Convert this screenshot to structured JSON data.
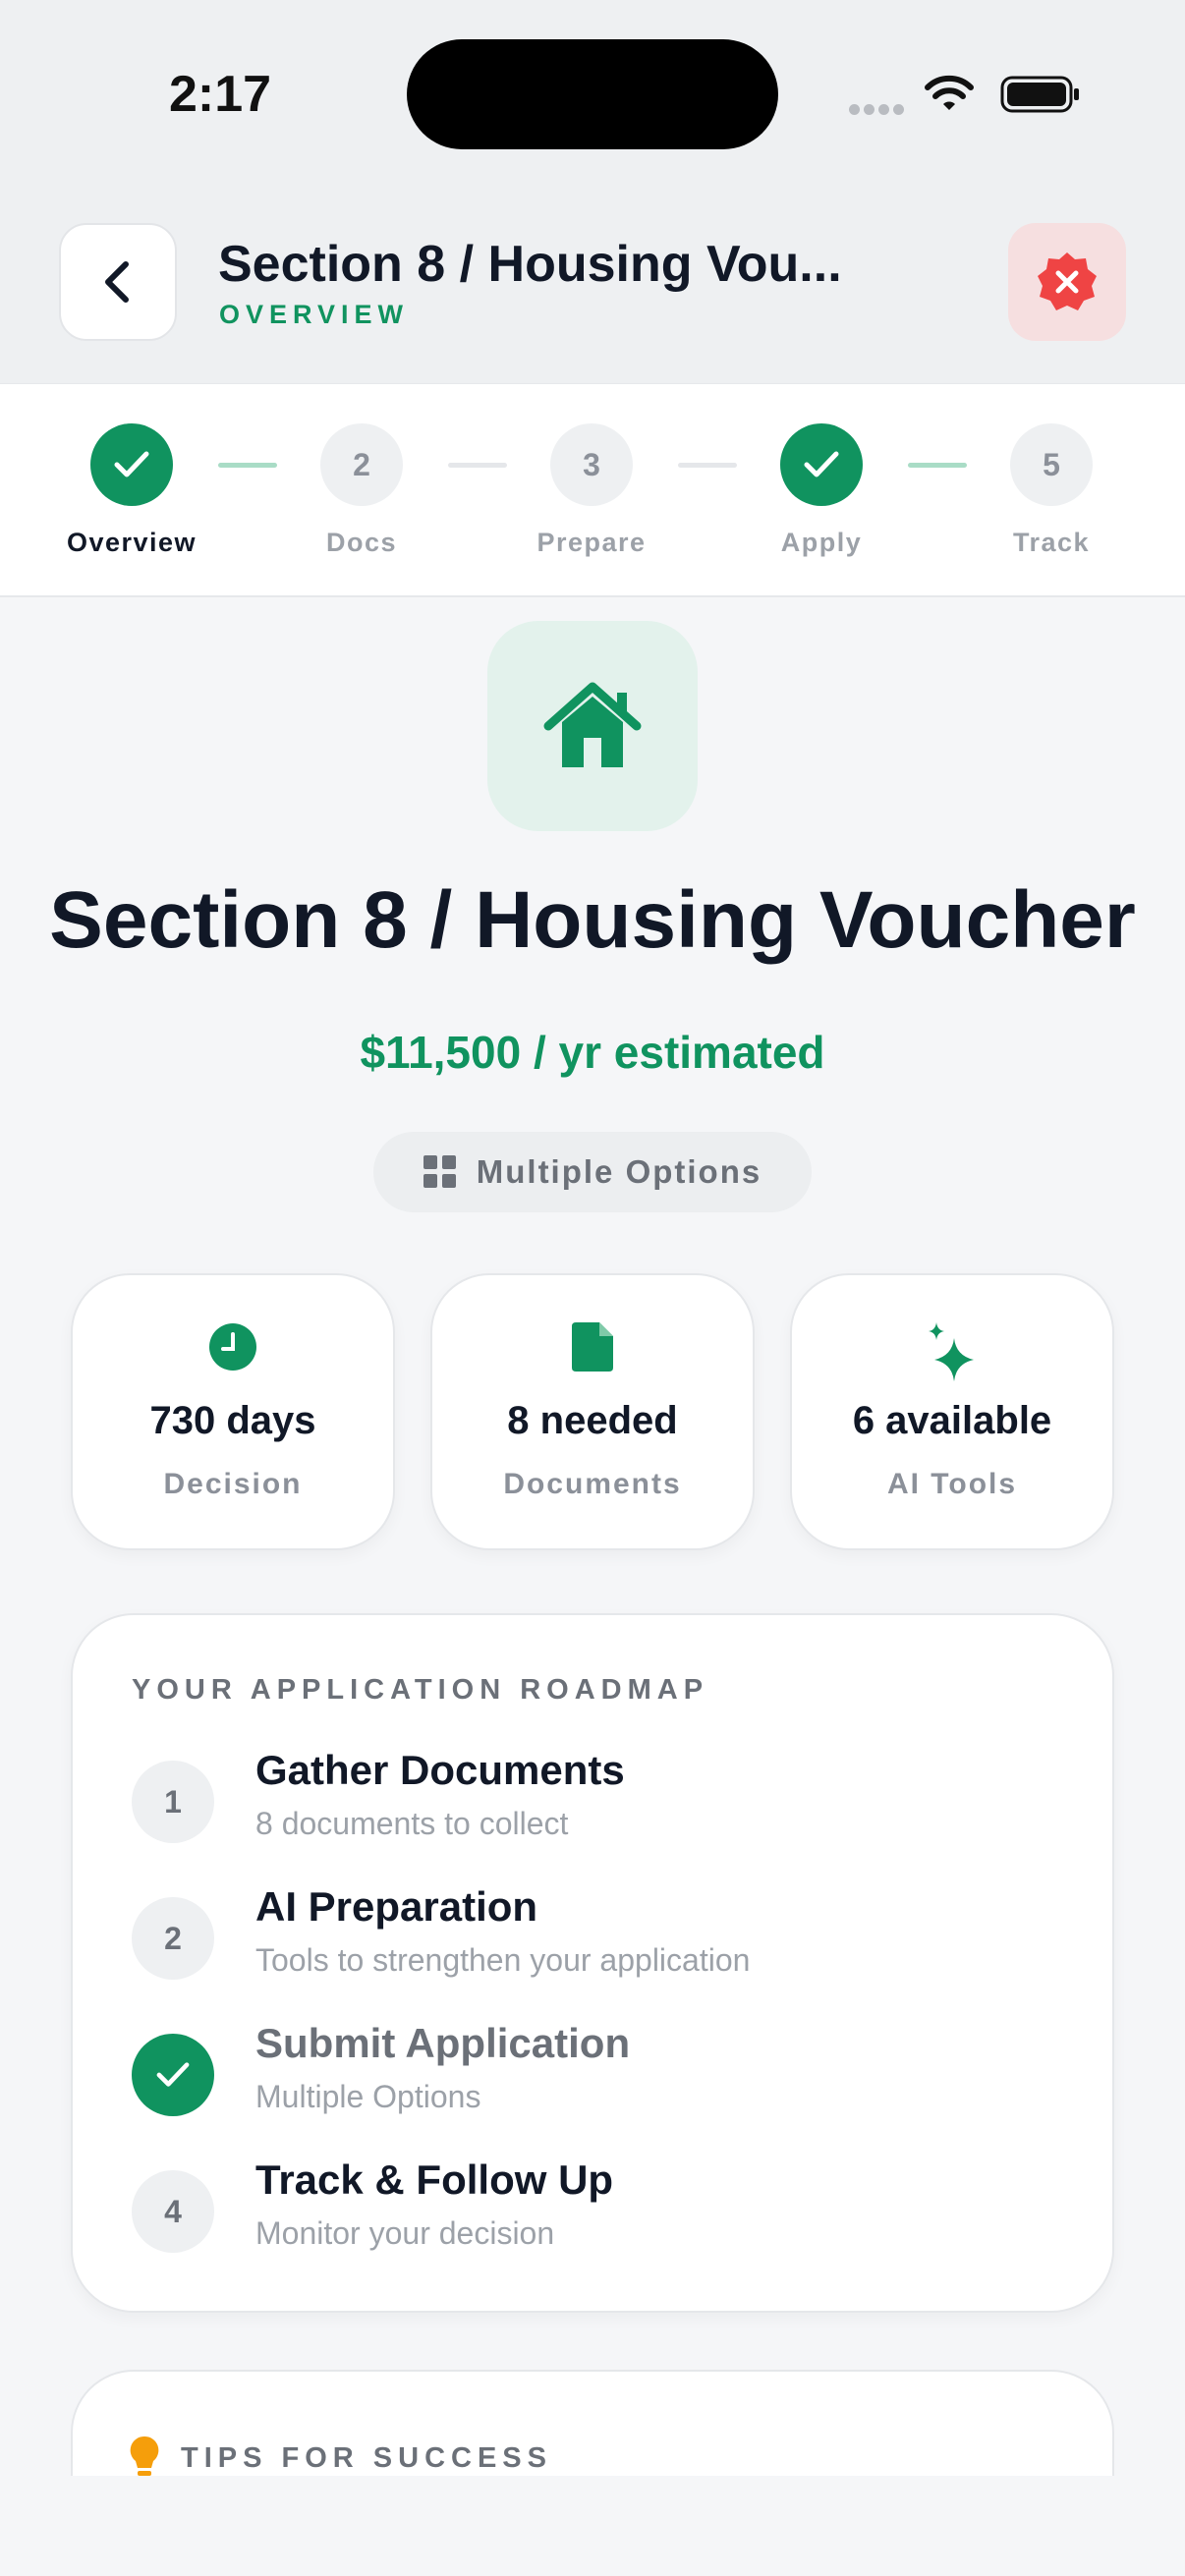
{
  "status_bar": {
    "time": "2:17"
  },
  "header": {
    "title": "Section 8 / Housing Vou...",
    "subtitle": "OVERVIEW"
  },
  "stepper": {
    "steps": [
      {
        "number": "",
        "label": "Overview",
        "state": "done",
        "active": true
      },
      {
        "number": "2",
        "label": "Docs",
        "state": "pending",
        "active": false
      },
      {
        "number": "3",
        "label": "Prepare",
        "state": "pending",
        "active": false
      },
      {
        "number": "",
        "label": "Apply",
        "state": "done",
        "active": false
      },
      {
        "number": "5",
        "label": "Track",
        "state": "pending",
        "active": false
      }
    ]
  },
  "hero": {
    "icon": "house-icon",
    "title": "Section 8 / Housing Voucher",
    "amount": "$11,500 / yr estimated",
    "options_label": "Multiple Options"
  },
  "stats": [
    {
      "icon": "clock-icon",
      "value": "730 days",
      "label": "Decision"
    },
    {
      "icon": "document-icon",
      "value": "8 needed",
      "label": "Documents"
    },
    {
      "icon": "sparkle-icon",
      "value": "6 available",
      "label": "AI Tools"
    }
  ],
  "roadmap": {
    "heading": "YOUR APPLICATION ROADMAP",
    "items": [
      {
        "number": "1",
        "title": "Gather Documents",
        "description": "8 documents to collect",
        "done": false
      },
      {
        "number": "2",
        "title": "AI Preparation",
        "description": "Tools to strengthen your application",
        "done": false
      },
      {
        "number": "",
        "title": "Submit Application",
        "description": "Multiple Options",
        "done": true
      },
      {
        "number": "4",
        "title": "Track & Follow Up",
        "description": "Monitor your decision",
        "done": false
      }
    ]
  },
  "tips": {
    "heading": "TIPS FOR SUCCESS",
    "icon": "lightbulb-icon"
  },
  "colors": {
    "accent": "#10935f",
    "accent_light": "#e3f2ec",
    "danger": "#ef4444",
    "text": "#111827",
    "muted": "#9ca1a8"
  }
}
